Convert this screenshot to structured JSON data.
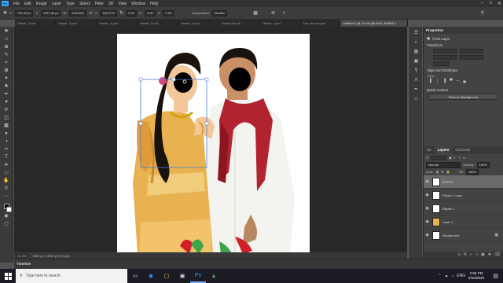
{
  "menu": {
    "logo": "Ps",
    "items": [
      "File",
      "Edit",
      "Image",
      "Layer",
      "Type",
      "Select",
      "Filter",
      "3D",
      "View",
      "Window",
      "Help"
    ]
  },
  "options_bar": {
    "x_label": "X:",
    "x_value": "704.00 px",
    "y_label": "Y:",
    "y_value": "1911.38 px",
    "w_label": "W:",
    "w_value": "206.81%",
    "h_label": "H:",
    "h_value": "182.37%",
    "angle_value": "0.00",
    "h_skew_label": "H:",
    "h_skew_value": "0.00",
    "v_skew_label": "V:",
    "v_skew_value": "0.00",
    "interp_label": "Interpolation:",
    "interp_value": "Bicubic"
  },
  "doc_tabs": [
    {
      "label": "Haasir -2.psd"
    },
    {
      "label": "Haasir -3.psd"
    },
    {
      "label": "Haasir -4.psd"
    },
    {
      "label": "Haasir -5.psd"
    },
    {
      "label": "Haasir -6.psd"
    },
    {
      "label": "Haasir.psd @..."
    },
    {
      "label": "Haasir +.psd"
    },
    {
      "label": "hair strocks.psd"
    },
    {
      "label": "Untitled-1 @ 24.4% (BLACK, RGB/8) *"
    }
  ],
  "status_bar": {
    "zoom": "24.4%",
    "doc_info": "3000 px x 3000 px (72 ppi)"
  },
  "timeline_label": "Timeline",
  "properties": {
    "title": "Properties",
    "pixel_layer": "Pixel Layer",
    "transform": "Transform",
    "align_distribute": "Align and Distribute",
    "align": "Align:",
    "quick_actions": "Quick Actions",
    "remove_bg": "Remove Background"
  },
  "layers_panel": {
    "tabs": [
      "3D",
      "Layers",
      "Channels"
    ],
    "blend_mode": "Normal",
    "opacity_label": "Opacity:",
    "opacity_value": "100%",
    "lock_label": "Lock:",
    "fill_label": "Fill:",
    "fill_value": "100%",
    "layers": [
      {
        "name": "BLACK",
        "selected": true
      },
      {
        "name": "Ellipse 1 copy",
        "selected": false
      },
      {
        "name": "Ellipse 1",
        "selected": false
      },
      {
        "name": "Layer 1",
        "selected": false
      },
      {
        "name": "Background",
        "selected": false
      }
    ]
  },
  "taskbar": {
    "search_placeholder": "Type here to search",
    "lang": "ENG",
    "time": "2:56 PM",
    "date": "6/15/2020"
  },
  "colors": {
    "skin": "#f3c79a",
    "saree_gold": "#e7b24f",
    "sherwani": "#f3f3ef",
    "stole_red": "#b22330",
    "hair": "#1a120c"
  },
  "icons": [
    "search-icon",
    "windows-start-icon",
    "eye-icon",
    "lock-icon",
    "move-tool-icon",
    "cancel-transform-icon",
    "commit-transform-icon"
  ]
}
